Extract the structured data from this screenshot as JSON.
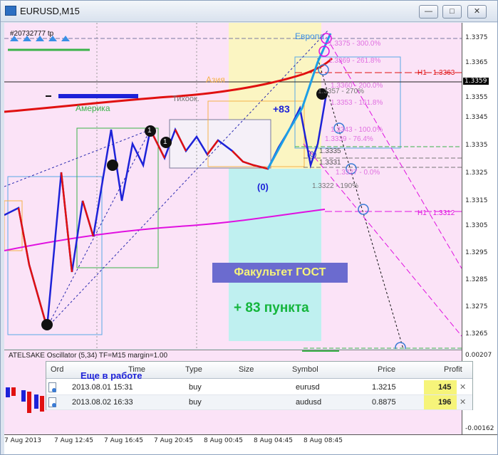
{
  "window": {
    "title": "EURUSD,M15",
    "controls": [
      "minimize",
      "restore",
      "close"
    ]
  },
  "chart": {
    "order_tag": "#20732777 tp",
    "sessions": {
      "europe": "Европа",
      "asia": "Азия",
      "america": "Америка",
      "quiet": "Тихоок."
    },
    "labels": {
      "plus83": "+83",
      "zero1": "(0)",
      "zero2": "(0)",
      "one_a": "1",
      "one_b": "1"
    },
    "fib_levels": [
      {
        "text": "1.3375 - 300.0%"
      },
      {
        "text": "1.3369 - 261.8%"
      },
      {
        "text": "1.3360 - 200.0%"
      },
      {
        "text": "1.3357 - 270%"
      },
      {
        "text": "1.3353 - 161.8%"
      },
      {
        "text": "1.3343 - 100.0%"
      },
      {
        "text": "1.3339 - 76.4%"
      },
      {
        "text": "1.3335"
      },
      {
        "text": "1.3331"
      },
      {
        "text": "1.3327 - 0.0%"
      },
      {
        "text": "1.3322 - 190%"
      }
    ],
    "h1_labels": {
      "upper": "H1 - 1.3363",
      "lower": "H1 - 1.3312"
    },
    "overlay": {
      "faculty": "Факультет ГОСТ",
      "result": "+ 83 пункта"
    }
  },
  "price_axis": {
    "ticks": [
      "1.3375",
      "1.3365",
      "1.3355",
      "1.3345",
      "1.3335",
      "1.3325",
      "1.3315",
      "1.3305",
      "1.3295",
      "1.3285",
      "1.3275",
      "1.3265"
    ],
    "current": "1.3359",
    "osc_ticks": [
      "0.00207",
      "-0.00162"
    ]
  },
  "oscillator": {
    "title": "ATELSAKE Oscillator (5,34) TF=M15 margin=1.00"
  },
  "time_axis": {
    "labels": [
      "7 Aug 2013",
      "7 Aug 12:45",
      "7 Aug 16:45",
      "7 Aug 20:45",
      "8 Aug 00:45",
      "8 Aug 04:45",
      "8 Aug 08:45"
    ]
  },
  "orders": {
    "headers": [
      "Ord",
      "Time",
      "Type",
      "Size",
      "Symbol",
      "Price",
      "Profit"
    ],
    "banner": "Еще в работе",
    "rows": [
      {
        "time": "2013.08.01 15:31",
        "type": "buy",
        "symbol": "eurusd",
        "price": "1.3215",
        "profit": "145"
      },
      {
        "time": "2013.08.02 16:33",
        "type": "buy",
        "symbol": "audusd",
        "price": "0.8875",
        "profit": "196"
      }
    ]
  },
  "colors": {
    "chart_bg": "#fbe3f7",
    "bull": "#1d22d8",
    "bear": "#e01010",
    "ma_red": "#e01010",
    "ma_magenta": "#e010e0",
    "profit_highlight": "#f6f47a"
  }
}
